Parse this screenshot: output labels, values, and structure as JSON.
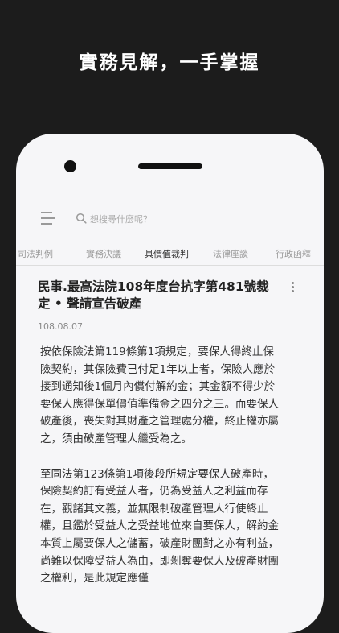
{
  "promo": {
    "headline": "實務見解，一手掌握"
  },
  "search": {
    "placeholder": "想搜尋什麼呢？"
  },
  "tabs": [
    {
      "label": "司法判例"
    },
    {
      "label": "實務決議"
    },
    {
      "label": "具價值裁判"
    },
    {
      "label": "法律座談"
    },
    {
      "label": "行政函釋"
    }
  ],
  "active_tab": "具價值裁判",
  "article": {
    "title": "民事.最高法院108年度台抗字第481號裁定 • 聲請宣告破產",
    "date": "108.08.07",
    "paragraphs": [
      "按依保險法第119條第1項規定，要保人得終止保險契約，其保險費已付足1年以上者，保險人應於接到通知後1個月內償付解約金；其金額不得少於要保人應得保單價值準備金之四分之三。而要保人破產後，喪失對其財產之管理處分權，終止權亦屬之，須由破產管理人繼受為之。",
      "至同法第123條第1項後段所規定要保人破產時，保險契約訂有受益人者，仍為受益人之利益而存在，觀諸其文義，並無限制破產管理人行使終止權，且鑑於受益人之受益地位來自要保人，解約金本質上屬要保人之儲蓄，破產財團對之亦有利益，尚難以保障受益人為由，即剝奪要保人及破產財團之權利，是此規定應僅"
    ]
  }
}
